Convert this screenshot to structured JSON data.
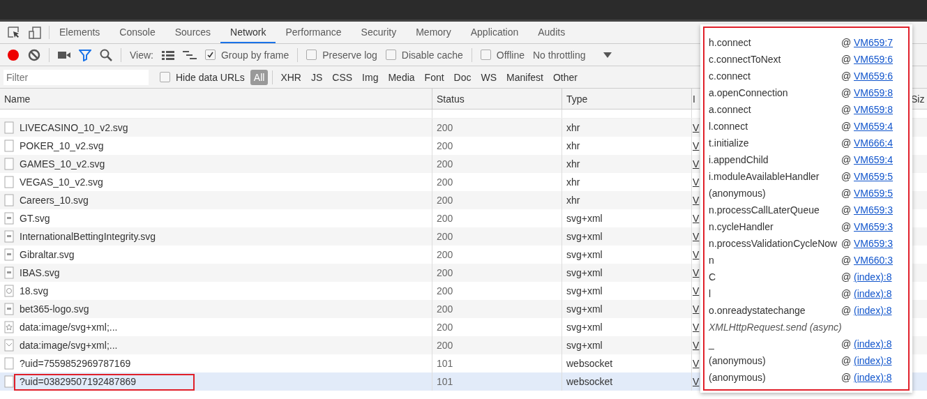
{
  "tabs": [
    {
      "label": "Elements",
      "selected": false
    },
    {
      "label": "Console",
      "selected": false
    },
    {
      "label": "Sources",
      "selected": false
    },
    {
      "label": "Network",
      "selected": true
    },
    {
      "label": "Performance",
      "selected": false
    },
    {
      "label": "Security",
      "selected": false
    },
    {
      "label": "Memory",
      "selected": false
    },
    {
      "label": "Application",
      "selected": false
    },
    {
      "label": "Audits",
      "selected": false
    }
  ],
  "toolbar": {
    "recording": true,
    "filter_active": true,
    "view_label": "View:",
    "checkbox_groups": [
      [
        {
          "label": "Group by frame",
          "checked": true
        }
      ],
      [
        {
          "label": "Preserve log",
          "checked": false
        },
        {
          "label": "Disable cache",
          "checked": false
        }
      ],
      [
        {
          "label": "Offline",
          "checked": false
        }
      ]
    ],
    "throttling": "No throttling"
  },
  "filter_bar": {
    "placeholder": "Filter",
    "hide_data_urls": {
      "label": "Hide data URLs",
      "checked": false
    },
    "types": [
      {
        "label": "All",
        "selected": true
      },
      {
        "label": "XHR",
        "selected": false
      },
      {
        "label": "JS",
        "selected": false
      },
      {
        "label": "CSS",
        "selected": false
      },
      {
        "label": "Img",
        "selected": false
      },
      {
        "label": "Media",
        "selected": false
      },
      {
        "label": "Font",
        "selected": false
      },
      {
        "label": "Doc",
        "selected": false
      },
      {
        "label": "WS",
        "selected": false
      },
      {
        "label": "Manifest",
        "selected": false
      },
      {
        "label": "Other",
        "selected": false
      }
    ]
  },
  "table": {
    "columns": [
      "Name",
      "Status",
      "Type",
      "I",
      "Siz"
    ],
    "rows": [
      {
        "name": "LIVECASINO_10_v2.svg",
        "kind": "blank",
        "status": "200",
        "type": "xhr",
        "initiator": "V",
        "selected": false,
        "annotated": false
      },
      {
        "name": "POKER_10_v2.svg",
        "kind": "blank",
        "status": "200",
        "type": "xhr",
        "initiator": "V",
        "selected": false,
        "annotated": false
      },
      {
        "name": "GAMES_10_v2.svg",
        "kind": "blank",
        "status": "200",
        "type": "xhr",
        "initiator": "V",
        "selected": false,
        "annotated": false
      },
      {
        "name": "VEGAS_10_v2.svg",
        "kind": "blank",
        "status": "200",
        "type": "xhr",
        "initiator": "V",
        "selected": false,
        "annotated": false
      },
      {
        "name": "Careers_10.svg",
        "kind": "blank",
        "status": "200",
        "type": "xhr",
        "initiator": "V",
        "selected": false,
        "annotated": false
      },
      {
        "name": "GT.svg",
        "kind": "thumbnail",
        "status": "200",
        "type": "svg+xml",
        "initiator": "V",
        "selected": false,
        "annotated": false
      },
      {
        "name": "InternationalBettingIntegrity.svg",
        "kind": "thumbnail",
        "status": "200",
        "type": "svg+xml",
        "initiator": "V",
        "selected": false,
        "annotated": false
      },
      {
        "name": "Gibraltar.svg",
        "kind": "thumbnail",
        "status": "200",
        "type": "svg+xml",
        "initiator": "V",
        "selected": false,
        "annotated": false
      },
      {
        "name": "IBAS.svg",
        "kind": "thumbnail",
        "status": "200",
        "type": "svg+xml",
        "initiator": "V",
        "selected": false,
        "annotated": false
      },
      {
        "name": "18.svg",
        "kind": "circle",
        "status": "200",
        "type": "svg+xml",
        "initiator": "V",
        "selected": false,
        "annotated": false
      },
      {
        "name": "bet365-logo.svg",
        "kind": "thumbnail",
        "status": "200",
        "type": "svg+xml",
        "initiator": "V",
        "selected": false,
        "annotated": false
      },
      {
        "name": "data:image/svg+xml;...",
        "kind": "star",
        "status": "200",
        "type": "svg+xml",
        "initiator": "V",
        "selected": false,
        "annotated": false
      },
      {
        "name": "data:image/svg+xml;...",
        "kind": "chevron",
        "status": "200",
        "type": "svg+xml",
        "initiator": "V",
        "selected": false,
        "annotated": false
      },
      {
        "name": "?uid=7559852969787169",
        "kind": "blank",
        "status": "101",
        "type": "websocket",
        "initiator": "V",
        "selected": false,
        "annotated": false
      },
      {
        "name": "?uid=03829507192487869",
        "kind": "blank",
        "status": "101",
        "type": "websocket",
        "initiator": "V",
        "selected": true,
        "annotated": true
      }
    ]
  },
  "call_stack_popup": {
    "annotated": true,
    "frames": [
      {
        "kind": "frame",
        "function": "h.connect",
        "at": "@",
        "location": "VM659:7"
      },
      {
        "kind": "frame",
        "function": "c.connectToNext",
        "at": "@",
        "location": "VM659:6"
      },
      {
        "kind": "frame",
        "function": "c.connect",
        "at": "@",
        "location": "VM659:6"
      },
      {
        "kind": "frame",
        "function": "a.openConnection",
        "at": "@",
        "location": "VM659:8"
      },
      {
        "kind": "frame",
        "function": "a.connect",
        "at": "@",
        "location": "VM659:8"
      },
      {
        "kind": "frame",
        "function": "l.connect",
        "at": "@",
        "location": "VM659:4"
      },
      {
        "kind": "frame",
        "function": "t.initialize",
        "at": "@",
        "location": "VM666:4"
      },
      {
        "kind": "frame",
        "function": "i.appendChild",
        "at": "@",
        "location": "VM659:4"
      },
      {
        "kind": "frame",
        "function": "i.moduleAvailableHandler",
        "at": "@",
        "location": "VM659:5"
      },
      {
        "kind": "frame",
        "function": "(anonymous)",
        "at": "@",
        "location": "VM659:5"
      },
      {
        "kind": "frame",
        "function": "n.processCallLaterQueue",
        "at": "@",
        "location": "VM659:3"
      },
      {
        "kind": "frame",
        "function": "n.cycleHandler",
        "at": "@",
        "location": "VM659:3"
      },
      {
        "kind": "frame",
        "function": "n.processValidationCycleNow",
        "at": "@",
        "location": "VM659:3"
      },
      {
        "kind": "frame",
        "function": "n",
        "at": "@",
        "location": "VM660:3"
      },
      {
        "kind": "frame",
        "function": "C",
        "at": "@",
        "location": "(index):8"
      },
      {
        "kind": "frame",
        "function": "l",
        "at": "@",
        "location": "(index):8"
      },
      {
        "kind": "frame",
        "function": "o.onreadystatechange",
        "at": "@",
        "location": "(index):8"
      },
      {
        "kind": "async",
        "function": "XMLHttpRequest.send (async)"
      },
      {
        "kind": "frame",
        "function": "_",
        "at": "@",
        "location": "(index):8"
      },
      {
        "kind": "frame",
        "function": "(anonymous)",
        "at": "@",
        "location": "(index):8"
      },
      {
        "kind": "frame",
        "function": "(anonymous)",
        "at": "@",
        "location": "(index):8"
      }
    ]
  }
}
